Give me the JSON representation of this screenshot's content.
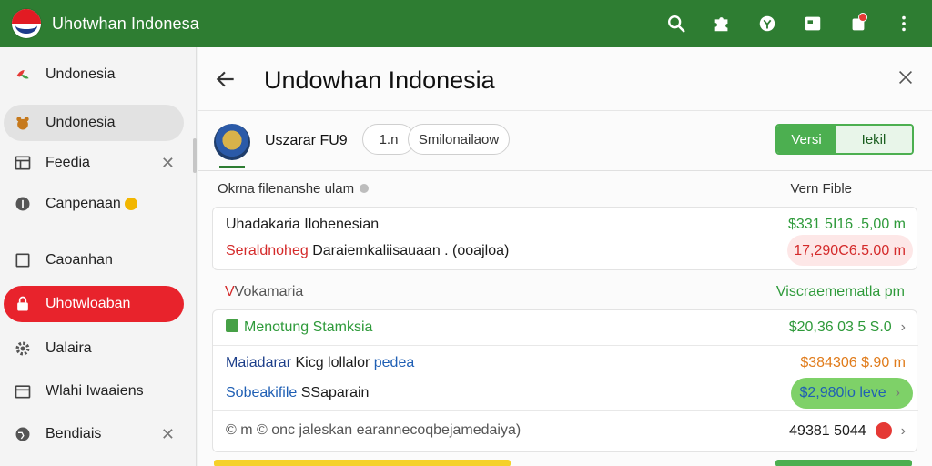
{
  "app": {
    "title": "Uhotwhan Indonesa"
  },
  "topbar": {
    "icons": [
      "search-icon",
      "puzzle-icon",
      "shield-icon",
      "image-icon",
      "notifications-icon",
      "more-vert-icon"
    ]
  },
  "sidebar": {
    "items": [
      {
        "label": "Undonesia",
        "icon": "leaf-icon"
      },
      {
        "label": "Undonesia",
        "icon": "bear-icon"
      },
      {
        "label": "Feedia",
        "icon": "calendar-icon"
      },
      {
        "label": "Canpenaan",
        "icon": "info-icon"
      },
      {
        "label": "Caoanhan",
        "icon": "square-icon"
      },
      {
        "label": "Uhotwloaban",
        "icon": "lock-icon"
      },
      {
        "label": "Ualaira",
        "icon": "gear-icon"
      },
      {
        "label": "Wlahi Iwaaiens",
        "icon": "tablet-icon"
      },
      {
        "label": "Bendiais",
        "icon": "globe-icon"
      }
    ]
  },
  "header": {
    "title": "Undowhan Indonesia"
  },
  "info": {
    "name": "Uszarar FU9",
    "chip1": "1.n",
    "chip2": "Smilonailaow",
    "seg_on": "Versi",
    "seg_off": "Iekil"
  },
  "list": {
    "head_left": "Okrna filenanshe ulam",
    "head_right": "Vern Fible"
  },
  "rows": {
    "r1_left": "Uhadakaria Ilohenesian",
    "r1_right": "$331 5I16 .5,00 m",
    "r2_left_a": "Seraldnoheg",
    "r2_left_b": "Daraiemkaliisauaan . (ooajloa)",
    "r2_right": "17,290C6.5.00 m",
    "r3_left": "Vokamaria",
    "r3_right": "Viscraemematla pm",
    "r4_left": "Menotung Stamksia",
    "r4_right": "$20,36 03 5 S.0",
    "r5_left_a": "Maiadarar",
    "r5_left_b": "Kicg lollalor",
    "r5_left_c": "pedea",
    "r5_right": "$384306 $.90 m",
    "r6_left_a": "Sobeakifile",
    "r6_left_b": "SSaparain",
    "r6_right": "$2,980lo leve",
    "r7_left": "© m © onc jaleskan earannecoqbejamedaiya)",
    "r7_right": "49381 5044"
  }
}
